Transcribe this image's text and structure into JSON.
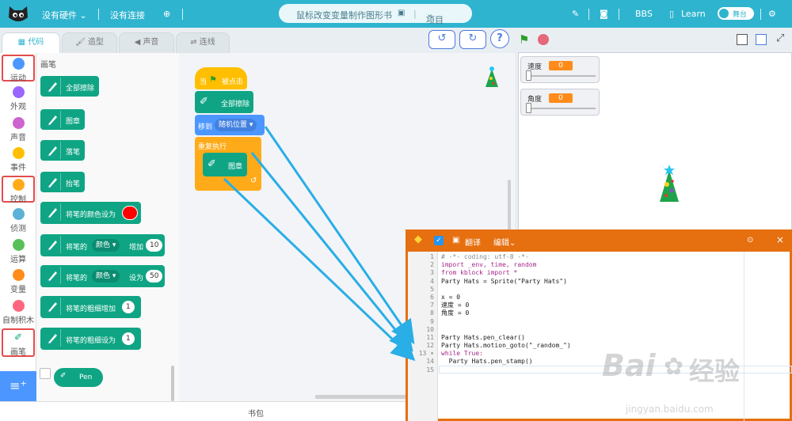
{
  "topbar": {
    "hardware": "没有硬件",
    "connection": "没有连接",
    "project_title": "鼠标改变变量制作图形书",
    "project_menu": "项目",
    "bbs": "BBS",
    "learn": "Learn",
    "stage_label": "舞台"
  },
  "tabs": {
    "code": "代码",
    "costume": "造型",
    "sound": "声音",
    "connect": "连线"
  },
  "categories": [
    "运动",
    "外观",
    "声音",
    "事件",
    "控制",
    "侦测",
    "运算",
    "变量",
    "自制积木",
    "画笔"
  ],
  "palette": {
    "title": "画笔",
    "clear": "全部擦除",
    "stamp": "图章",
    "pen_down": "落笔",
    "pen_up": "抬笔",
    "set_color": "将笔的颜色设为",
    "change_param_pre": "将笔的",
    "change_param_dd": "颜色",
    "change_param_mid": "增加",
    "change_param_val": "10",
    "set_param_pre": "将笔的",
    "set_param_dd": "颜色",
    "set_param_mid": "设为",
    "set_param_val": "50",
    "change_size": "将笔的粗细增加",
    "change_size_val": "1",
    "set_size": "将笔的粗细设为",
    "set_size_val": "1",
    "ext_label": "Pen"
  },
  "script": {
    "hat_pre": "当",
    "hat_post": "被点击",
    "clear": "全部擦除",
    "goto": "移到",
    "goto_dd": "随机位置",
    "forever": "重复执行",
    "stamp": "图章"
  },
  "bottom": {
    "backpack": "书包"
  },
  "monitors": [
    {
      "name": "速度",
      "value": "0"
    },
    {
      "name": "角度",
      "value": "0"
    }
  ],
  "python": {
    "translate": "翻译",
    "edit": "编辑",
    "lines": [
      "# -*- coding: utf-8 -*-",
      "import _env, time, random",
      "from kblock import *",
      "Party Hats = Sprite(\"Party Hats\")",
      "",
      "x = 0",
      "速度 = 0",
      "角度 = 0",
      "",
      "",
      "Party Hats.pen_clear()",
      "Party Hats.motion_goto(\"_random_\")",
      "while True:",
      "  Party Hats.pen_stamp()",
      ""
    ],
    "line_numbers": [
      "1",
      "2",
      "3",
      "4",
      "5",
      "6",
      "7",
      "8",
      "9",
      "10",
      "11",
      "12",
      "13 ▾",
      "14",
      "15"
    ]
  },
  "watermark": {
    "brand": "Bai",
    "brand2": "经验",
    "url": "jingyan.baidu.com"
  },
  "colors": {
    "topbar": "#2fb4cf",
    "pen_block": "#0fa584",
    "event": "#ffbf00",
    "control": "#ffab19",
    "motion": "#4c97ff",
    "python_frame": "#e66f0f",
    "arrow": "#29aee6"
  }
}
